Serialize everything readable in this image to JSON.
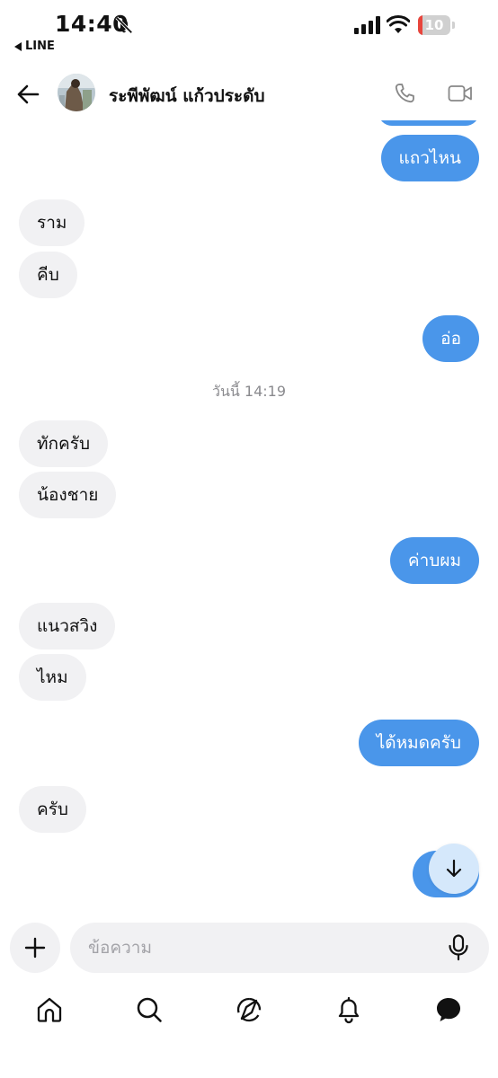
{
  "status_bar": {
    "time": "14:40",
    "back_app": "LINE",
    "battery": "10",
    "battery_level": 0.1
  },
  "header": {
    "contact_name": "ระพีพัฒน์ แก้วประดับ"
  },
  "messages": [
    {
      "side": "out",
      "text": "แถวไหน"
    },
    {
      "side": "in",
      "text": "ราม"
    },
    {
      "side": "in",
      "text": "คีบ"
    },
    {
      "side": "out",
      "text": "อ่อ"
    },
    {
      "side": "in",
      "text": "ทักครับ"
    },
    {
      "side": "in",
      "text": "น้องชาย"
    },
    {
      "side": "out",
      "text": "ค่าบผม"
    },
    {
      "side": "in",
      "text": "แนวสวิง"
    },
    {
      "side": "in",
      "text": "ไหม"
    },
    {
      "side": "out",
      "text": "ได้หมดครับ"
    },
    {
      "side": "in",
      "text": "ครับ"
    }
  ],
  "date_separator": "วันนี้ 14:19",
  "composer": {
    "placeholder": "ข้อความ"
  },
  "tabs": [
    {
      "name": "home",
      "icon": "home-icon",
      "active": false
    },
    {
      "name": "search",
      "icon": "search-icon",
      "active": false
    },
    {
      "name": "explore",
      "icon": "compass-icon",
      "active": false
    },
    {
      "name": "notifications",
      "icon": "bell-icon",
      "active": false
    },
    {
      "name": "messages",
      "icon": "chat-bubble-icon",
      "active": true
    }
  ],
  "colors": {
    "outgoing_bubble": "#4a96ea",
    "incoming_bubble": "#f1f1f3",
    "battery_low": "#e8453c"
  }
}
